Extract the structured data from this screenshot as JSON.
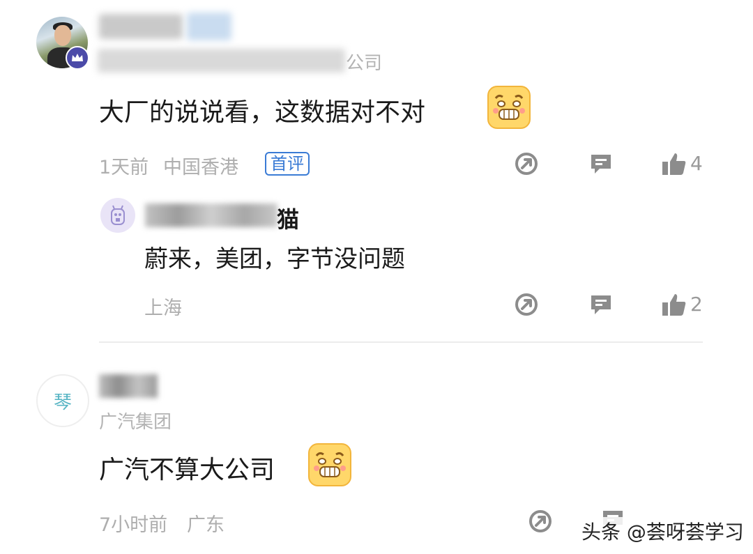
{
  "comments": [
    {
      "company_suffix": "公司",
      "text": "大厂的说说看，这数据对不对",
      "time": "1天前",
      "location": "中国香港",
      "badge": "首评",
      "likes": "4",
      "reply": {
        "name_suffix": "猫",
        "text": "蔚来，美团，字节没问题",
        "location": "上海",
        "likes": "2"
      }
    },
    {
      "avatar_char": "琴",
      "company": "广汽集团",
      "text": "广汽不算大公司",
      "time": "7小时前",
      "location": "广东"
    }
  ],
  "watermark": "头条 @荟呀荟学习",
  "icons": {
    "share": "share-icon",
    "reply": "comment-icon",
    "like": "thumbs-up-icon",
    "emoji": "grin-emoji-icon",
    "crown": "crown-icon"
  },
  "colors": {
    "badge_blue": "#3a7bd5",
    "crown_purple": "#4b4aa8",
    "meta_gray": "#aeaeae",
    "icon_gray": "#8c8c8c"
  }
}
